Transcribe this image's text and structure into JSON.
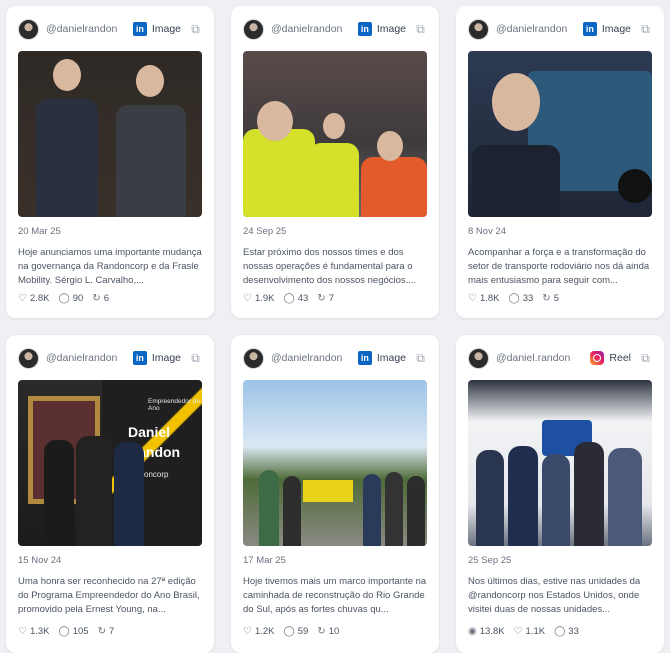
{
  "cards": [
    {
      "handle": "@danielrandon",
      "source_label": "Image",
      "source_icon": "linkedin-icon",
      "date": "20 Mar 25",
      "text": "Hoje anunciamos uma importante mudança na governança da Randoncorp e da Frasle Mobility. Sérgio L. Carvalho,...",
      "likes": "2.8K",
      "comments": "90",
      "shares": "6"
    },
    {
      "handle": "@danielrandon",
      "source_label": "Image",
      "source_icon": "linkedin-icon",
      "date": "24 Sep 25",
      "text": "Estar próximo dos nossos times e dos nossas operações é fundamental para o desenvolvimento dos nossos negócios....",
      "likes": "1.9K",
      "comments": "43",
      "shares": "7"
    },
    {
      "handle": "@danielrandon",
      "source_label": "Image",
      "source_icon": "linkedin-icon",
      "date": "8 Nov 24",
      "text": "Acompanhar a força e a transformação do setor de transporte rodoviário nos dá ainda mais entusiasmo para seguir com...",
      "likes": "1.8K",
      "comments": "33",
      "shares": "5"
    },
    {
      "handle": "@danielrandon",
      "source_label": "Image",
      "source_icon": "linkedin-icon",
      "date": "15 Nov 24",
      "text": "Uma honra ser reconhecido na 27ª edição do Programa Empreendedor do Ano Brasil, promovido pela Ernest Young, na...",
      "likes": "1.3K",
      "comments": "105",
      "shares": "7",
      "photo_text": [
        "Empreendedor do Ano",
        "Daniel",
        "Randon",
        "randoncorp"
      ]
    },
    {
      "handle": "@danielrandon",
      "source_label": "Image",
      "source_icon": "linkedin-icon",
      "date": "17 Mar 25",
      "text": "Hoje tivemos mais um marco importante na caminhada de reconstrução do Rio Grande do Sul, após as fortes chuvas qu...",
      "likes": "1.2K",
      "comments": "59",
      "shares": "10"
    },
    {
      "handle": "@daniel.randon",
      "source_label": "Reel",
      "source_icon": "instagram-icon",
      "date": "25 Sep 25",
      "text": "Nos últimos dias, estive nas unidades da @randoncorp nos Estados Unidos, onde visitei duas de nossas unidades...",
      "views": "13.8K",
      "likes": "1.1K",
      "comments": "33"
    }
  ],
  "colors": {
    "linkedin": "#0a66c2",
    "instagram": "#e91e63",
    "background": "#eef0f4"
  }
}
